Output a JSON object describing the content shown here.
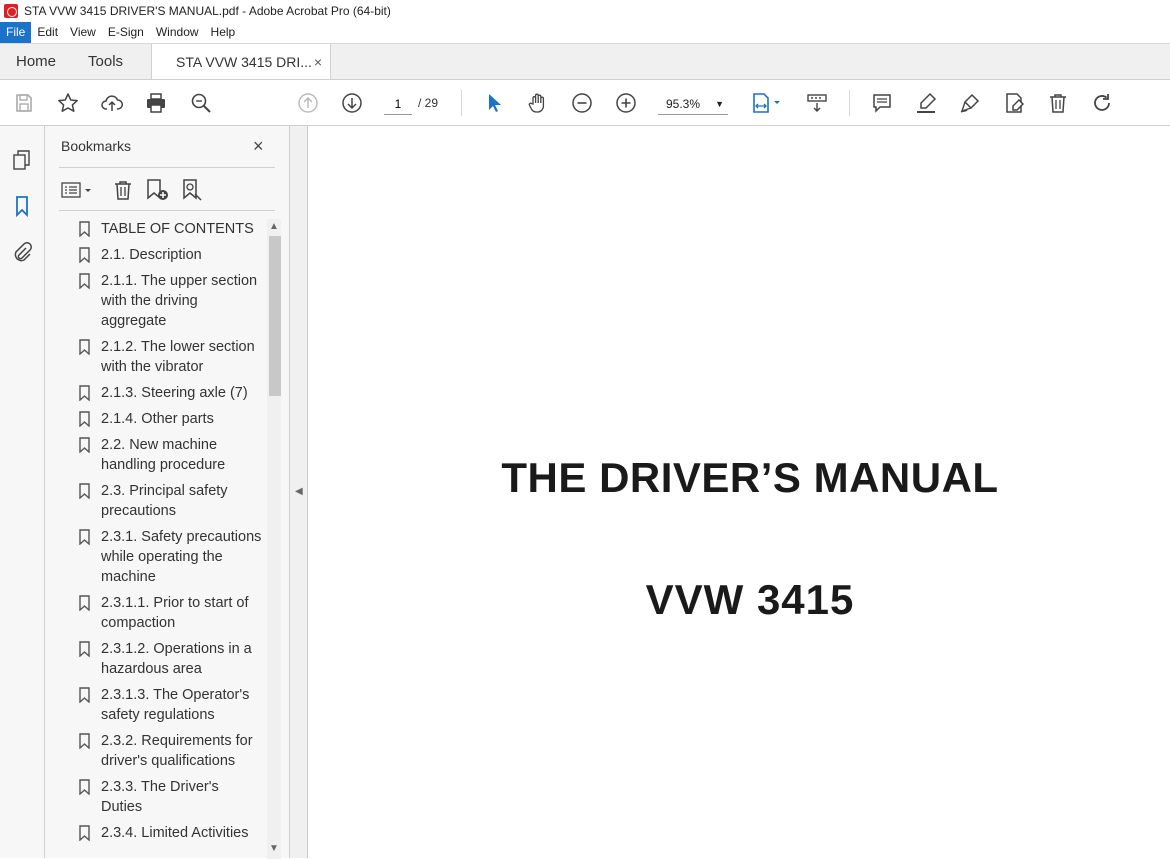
{
  "window": {
    "title": "STA VVW 3415 DRIVER'S MANUAL.pdf - Adobe Acrobat Pro (64-bit)"
  },
  "menu": [
    "File",
    "Edit",
    "View",
    "E-Sign",
    "Window",
    "Help"
  ],
  "tabs": {
    "home": "Home",
    "tools": "Tools",
    "document": "STA VVW 3415 DRI...",
    "document_close": "×"
  },
  "toolbar": {
    "page_current": "1",
    "page_total": "/ 29",
    "zoom": "95.3%",
    "accent_color": "#1a73c8"
  },
  "bookmarks": {
    "title": "Bookmarks",
    "close": "×",
    "items": [
      "TABLE OF CONTENTS",
      "2.1. Description",
      "2.1.1. The upper section with the driving aggregate",
      "2.1.2. The lower section with the vibrator",
      "2.1.3. Steering axle (7)",
      "2.1.4. Other parts",
      "2.2. New machine handling procedure",
      "2.3. Principal safety precautions",
      "2.3.1. Safety precautions while operating the machine",
      "2.3.1.1. Prior to start of compaction",
      "2.3.1.2. Operations in a hazardous area",
      "2.3.1.3. The Operator's safety regulations",
      "2.3.2. Requirements for driver's qualifications",
      "2.3.3. The Driver's Duties",
      "2.3.4. Limited Activities"
    ]
  },
  "document": {
    "title": "THE DRIVER’S MANUAL",
    "model": "VVW 3415"
  }
}
